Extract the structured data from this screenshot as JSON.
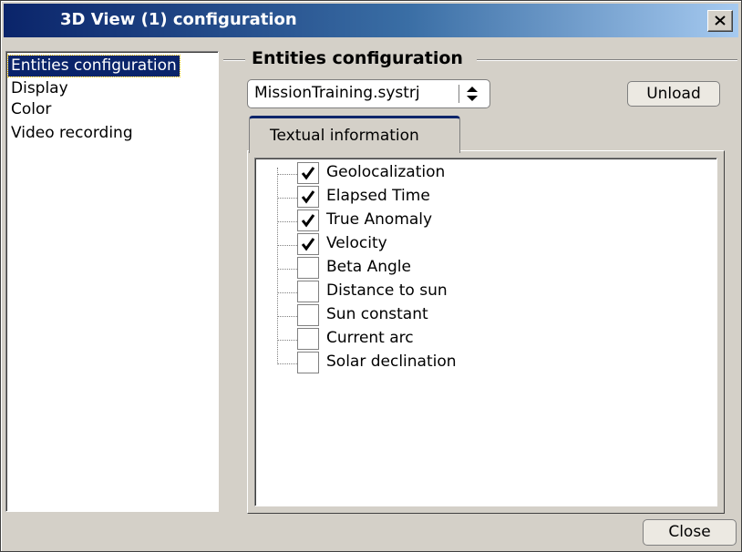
{
  "window": {
    "title": "3D View (1) configuration"
  },
  "nav": {
    "items": [
      {
        "label": "Entities configuration",
        "selected": true
      },
      {
        "label": "Display",
        "selected": false
      },
      {
        "label": "Color",
        "selected": false
      },
      {
        "label": "Video recording",
        "selected": false
      }
    ]
  },
  "group": {
    "title": "Entities configuration"
  },
  "file_select": {
    "value": "MissionTraining.systrj"
  },
  "unload_label": "Unload",
  "tab": {
    "label": "Textual information"
  },
  "tree": {
    "items": [
      {
        "label": "Geolocalization",
        "checked": true
      },
      {
        "label": "Elapsed Time",
        "checked": true
      },
      {
        "label": "True Anomaly",
        "checked": true
      },
      {
        "label": "Velocity",
        "checked": true
      },
      {
        "label": "Beta Angle",
        "checked": false
      },
      {
        "label": "Distance to sun",
        "checked": false
      },
      {
        "label": "Sun constant",
        "checked": false
      },
      {
        "label": "Current arc",
        "checked": false
      },
      {
        "label": "Solar declination",
        "checked": false
      }
    ]
  },
  "close_label": "Close",
  "icons": {
    "check": "checkmark-icon",
    "close": "close-icon",
    "updown": "up-down-arrow-icon"
  },
  "colors": {
    "selection": "#0a246a",
    "title_start": "#0a246a",
    "title_end": "#a6caf0"
  }
}
